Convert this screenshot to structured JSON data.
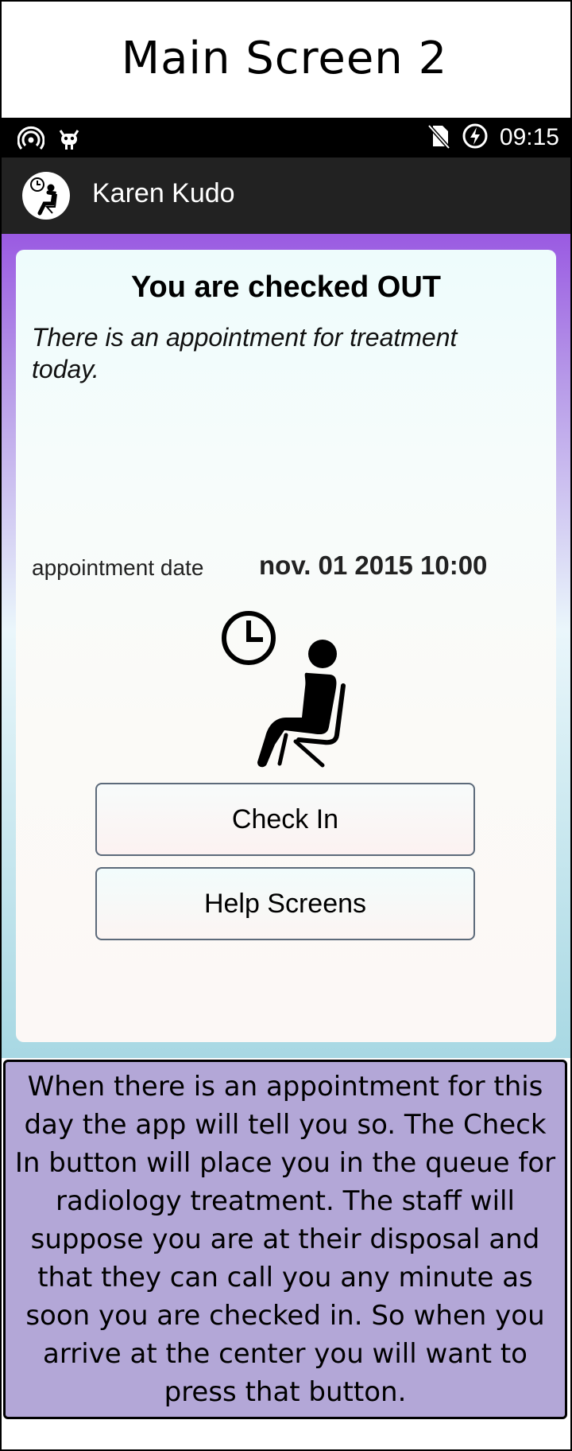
{
  "caption": {
    "title": "Main Screen 2"
  },
  "status_bar": {
    "time": "09:15",
    "icons_left": [
      "wifi-hotspot-icon",
      "android-debug-icon"
    ],
    "icons_right": [
      "no-sim-icon",
      "battery-charging-icon"
    ]
  },
  "app_bar": {
    "user_name": "Karen Kudo",
    "avatar_icon": "waiting-person-icon"
  },
  "main": {
    "status_title": "You are checked OUT",
    "note": "There is an appointment for treatment today.",
    "appointment_label": "appointment date",
    "appointment_value": "nov. 01 2015 10:00",
    "illustration_icon": "waiting-person-clock-icon",
    "buttons": {
      "check_in": "Check In",
      "help": "Help Screens"
    }
  },
  "description": "When there is an appointment for this day the app will tell you so. The Check In button will place you in the queue for radiology treatment. The staff will suppose you are at their disposal and that they can call you any minute as soon you are checked in. So when you arrive at the center you will want to press that button.",
  "colors": {
    "status_bar": "#000000",
    "app_bar": "#222222",
    "background_top": "#9a5ae2",
    "background_bottom": "#a8d8e3",
    "description_bg": "#b3a7d7"
  }
}
